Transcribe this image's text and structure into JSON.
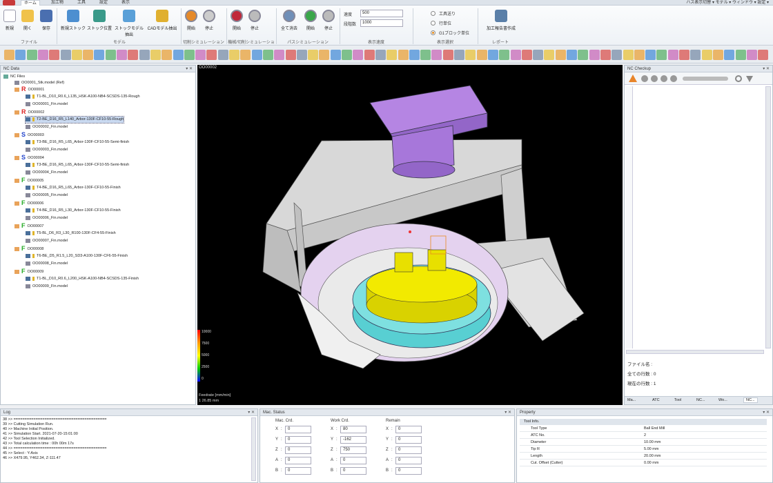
{
  "tabs": [
    "ホーム",
    "加工物",
    "工具",
    "設定",
    "表示"
  ],
  "top_right": "ハス表示切替 ▾  モデル ▾  ウィンドウ ▾  設定 ▾",
  "ribbon": {
    "buttons": [
      "新規",
      "開く",
      "保存",
      "新規ストック",
      "ストック位置",
      "ストックモデル抽出",
      "CADモデル抽出",
      "開始",
      "停止",
      "開始",
      "停止",
      "全て消去",
      "開始",
      "停止"
    ],
    "groups": [
      "ファイル",
      "モデル",
      "切削シミュレーション",
      "機械/切削シミュレーション",
      "パスシミュレーション",
      "表示速度",
      "表示選択",
      "レポート"
    ],
    "speed_label": "速度",
    "speed_value": "500",
    "step_label": "段階数",
    "step_value": "1000",
    "radios": [
      "工具送り",
      "行単位",
      "G1ブロック単位"
    ],
    "report_button": "加工報告書作成"
  },
  "nc_data": {
    "title": "NC Data",
    "root": "NC Files",
    "stock": "OO0001_Stk.model (Ref)",
    "programs": [
      {
        "id": "OO00001",
        "letter": "R",
        "color": "#d22",
        "tool": "T1-BL_D10_R0.6_L135_HSK-A100-NB4-SCSDS-135-Rough",
        "model": "OO00001_Fin.model"
      },
      {
        "id": "OO00002",
        "letter": "R",
        "color": "#d22",
        "tool": "T2-BE_D16_R5_L140_Arbor-130F-CF10-55-Rough",
        "model": "OO00002_Fin.model"
      },
      {
        "id": "OO00003",
        "letter": "S",
        "color": "#24c",
        "tool": "T3-BE_D16_R5_L65_Arbor-130F-CF10-55-Semi-finish",
        "model": "OO00003_Fin.model"
      },
      {
        "id": "OO00004",
        "letter": "S",
        "color": "#24c",
        "tool": "T3-BE_D16_R5_L65_Arbor-130F-CF10-55-Semi-finish",
        "model": "OO00004_Fin.model"
      },
      {
        "id": "OO00005",
        "letter": "F",
        "color": "#2a2",
        "tool": "T4-BE_D16_R5_L65_Arbor-130F-CF10-55-Finish",
        "model": "OO00005_Fin.model"
      },
      {
        "id": "OO00006",
        "letter": "F",
        "color": "#2a2",
        "tool": "T4-BE_D16_R5_L30_Arbor-130F-CF10-55-Finish",
        "model": "OO00006_Fin.model"
      },
      {
        "id": "OO00007",
        "letter": "F",
        "color": "#2a2",
        "tool": "T5-BL_D6_R3_L30_R100-130F-CF4-55-Finish",
        "model": "OO00007_Fin.model"
      },
      {
        "id": "OO00008",
        "letter": "F",
        "color": "#2a2",
        "tool": "T6-BE_D5_R1.5_L20_SD3-A100-130F-CF6-55-Finish",
        "model": "OO00008_Fin.model"
      },
      {
        "id": "OO00009",
        "letter": "F",
        "color": "#2a2",
        "tool": "T1-BL_D10_R0.6_L200_HSK-A100-NB4-SCSDS-135-Finish",
        "model": "OO00009_Fin.model"
      }
    ]
  },
  "viewport": {
    "title": "OO00002",
    "legend_values": [
      "10000",
      "7500",
      "5000",
      "2500",
      "0"
    ],
    "feed_label": "Feedrate  [mm/min]",
    "feed_value": "1 26.85 mm"
  },
  "nc_checkup": {
    "title": "NC Checkup",
    "file_label": "ファイル名 :",
    "all_lines": "全ての行数 : 0",
    "current_line": "現在の行数 : 1",
    "bottom_tabs": [
      "Ma...",
      "ATC",
      "Tool",
      "NC...",
      "Wo...",
      "NC..."
    ]
  },
  "log": {
    "title": "Log",
    "lines": [
      "38 >> ==========================================",
      "39 >> Cutting Simulation Run.",
      "40 >> Machine Initial Position.",
      "41 >> Simulation Start. 2021-07-20-15:01:00",
      "42 >> Tool Selection Initialized.",
      "43 >> Total calculation time : 00h 00m 17s",
      "44 >> ==========================================",
      "45 >> Select : Y-Axis",
      "46 >> X479.95, Y462.34, Z-111.47"
    ]
  },
  "mac_status": {
    "title": "Mac. Status",
    "columns": [
      "Mac. Crd.",
      "Work Crd.",
      "Remain"
    ],
    "axes": [
      "X",
      "Y",
      "Z",
      "A",
      "B"
    ],
    "mac": [
      "0",
      "0",
      "0",
      "0",
      "0"
    ],
    "work": [
      "80",
      "-162",
      "750",
      "0",
      "0"
    ],
    "remain": [
      "0",
      "0",
      "0",
      "0",
      "0"
    ]
  },
  "property": {
    "title": "Property",
    "section": "Tool Info.",
    "rows": [
      {
        "k": "Tool Type",
        "v": "Ball End Mill"
      },
      {
        "k": "ATC No.",
        "v": "2"
      },
      {
        "k": "Diameter",
        "v": "10.00 mm"
      },
      {
        "k": "Tip R",
        "v": "5.00 mm"
      },
      {
        "k": "Length",
        "v": "20.00 mm"
      },
      {
        "k": "Cut. Offset (Cutter)",
        "v": "0.00 mm"
      }
    ]
  },
  "colors": {
    "spindle": "#b07fe0",
    "table_yellow": "#f0e800",
    "table_cyan": "#5fd6d6",
    "machine_grey": "#e8e8e8",
    "cradle_pink": "#dcc6e8"
  }
}
